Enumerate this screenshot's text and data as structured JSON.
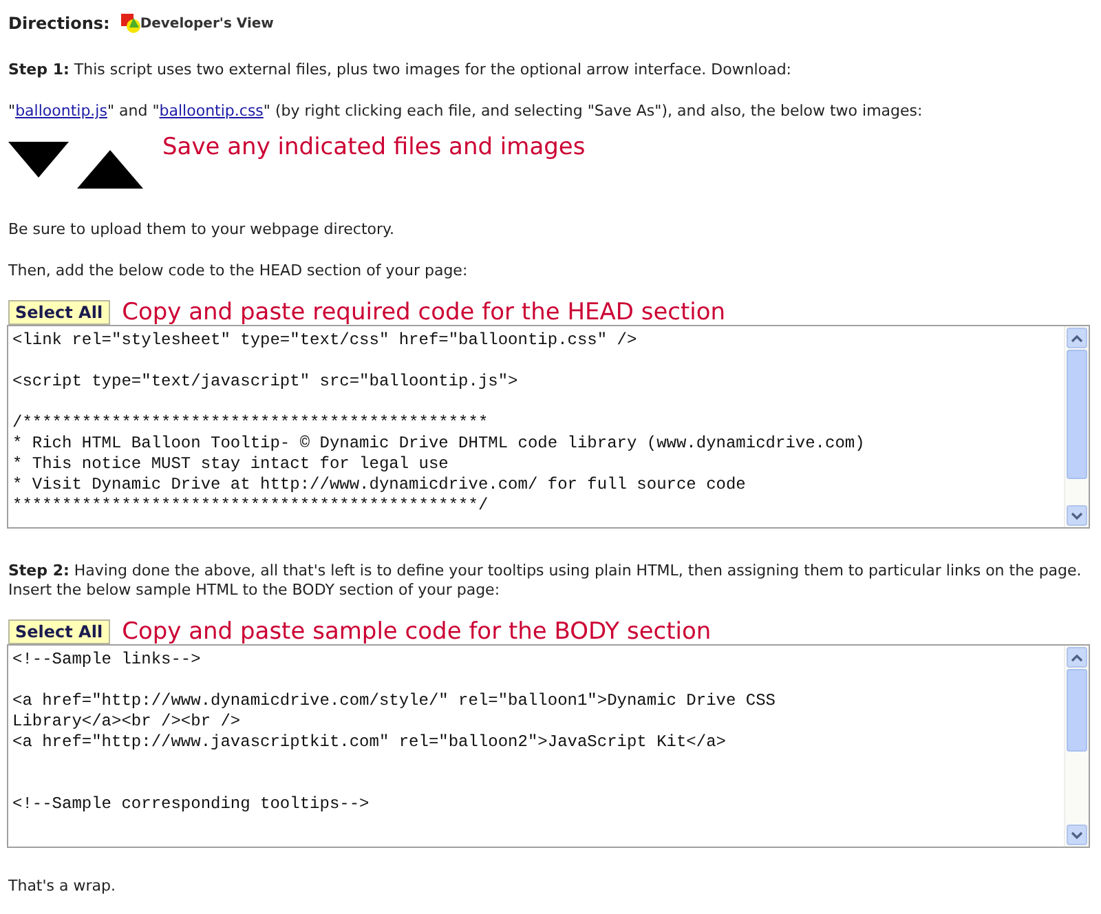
{
  "directions": {
    "label": "Directions:",
    "badge": "Developer's View"
  },
  "content": [
    {
      "kind": "paragraph",
      "text": "**Step 1:** This script uses two external files, plus two images for the optional arrow interface. Download:"
    },
    {
      "kind": "links",
      "segments": [
        {
          "text": "\"",
          "link": false
        },
        {
          "text": "balloontip.js",
          "link": true
        },
        {
          "text": "\" and \"",
          "link": false
        },
        {
          "text": "balloontip.css",
          "link": true
        },
        {
          "text": "\" (by right clicking each file, and selecting \"Save As\"), and also, the below two images:",
          "link": false
        }
      ]
    },
    {
      "kind": "images",
      "note": "Save any indicated files and images"
    },
    {
      "kind": "paragraph",
      "text": "Be sure to upload them to your webpage directory."
    },
    {
      "kind": "paragraph",
      "text": "Then, add the below code to the HEAD section of your page:"
    },
    {
      "kind": "code",
      "button": "Select All",
      "note": "Copy and paste required code for the HEAD section",
      "code": "<link rel=\"stylesheet\" type=\"text/css\" href=\"balloontip.css\" />\n\n<script type=\"text/javascript\" src=\"balloontip.js\">\n\n/***********************************************\n* Rich HTML Balloon Tooltip- © Dynamic Drive DHTML code library (www.dynamicdrive.com)\n* This notice MUST stay intact for legal use\n* Visit Dynamic Drive at http://www.dynamicdrive.com/ for full source code\n***********************************************/"
    },
    {
      "kind": "paragraph",
      "text": "**Step 2:** Having done the above, all that's left is to define your tooltips using plain HTML, then assigning them to particular links on the page. Insert the below sample HTML to the BODY section of your page:"
    },
    {
      "kind": "code",
      "button": "Select All",
      "note": "Copy and paste sample code for the BODY section",
      "code": "<!--Sample links-->\n\n<a href=\"http://www.dynamicdrive.com/style/\" rel=\"balloon1\">Dynamic Drive CSS\nLibrary</a><br /><br />\n<a href=\"http://www.javascriptkit.com\" rel=\"balloon2\">JavaScript Kit</a>\n\n\n<!--Sample corresponding tooltips-->"
    },
    {
      "kind": "paragraph",
      "text": "That's a wrap."
    }
  ]
}
